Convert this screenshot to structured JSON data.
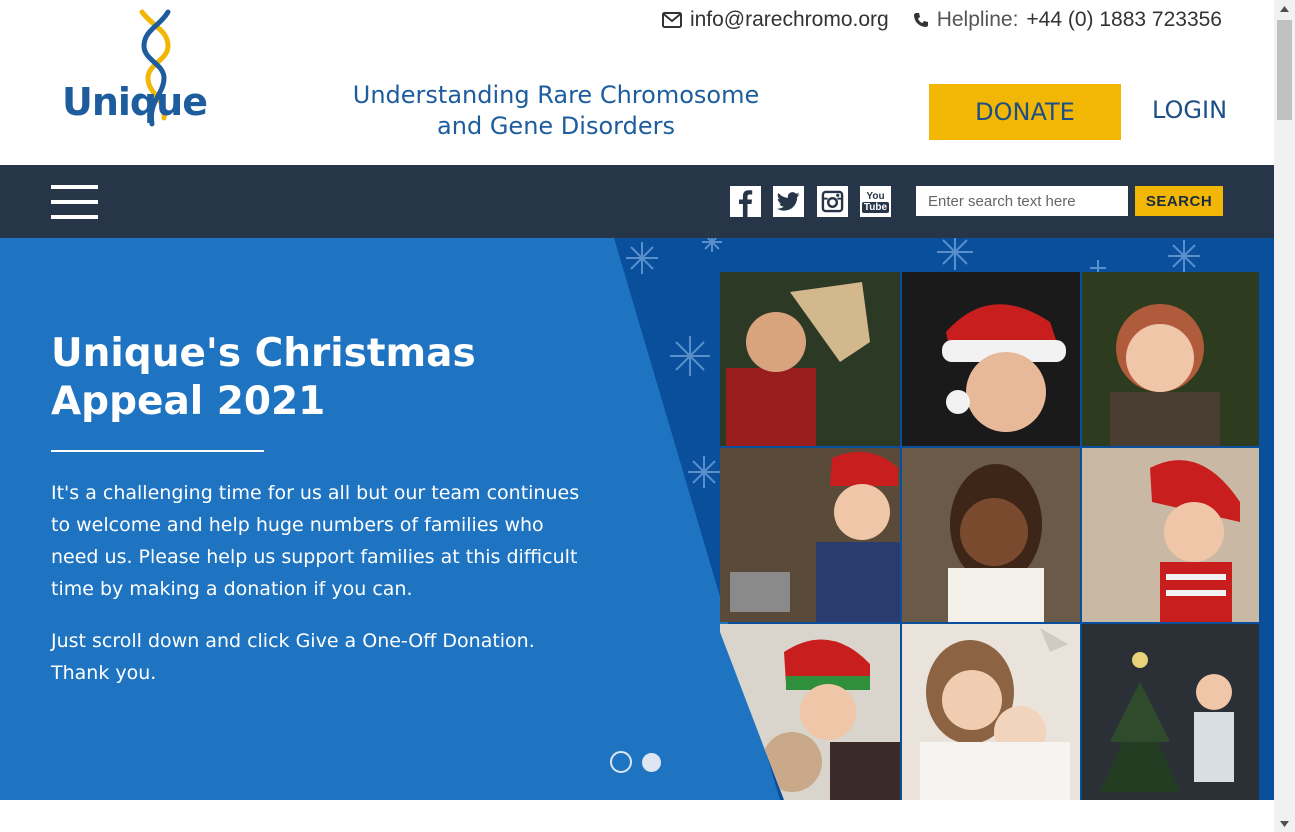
{
  "header": {
    "logo_text": "Unique",
    "email": "info@rarechromo.org",
    "helpline_label": "Helpline:",
    "helpline_number": "+44 (0) 1883 723356",
    "tagline_line1": "Understanding Rare Chromosome",
    "tagline_line2": "and Gene Disorders",
    "donate_label": "DONATE",
    "login_label": "LOGIN"
  },
  "nav": {
    "social_icons": [
      "facebook-icon",
      "twitter-icon",
      "instagram-icon",
      "youtube-icon"
    ],
    "youtube_line1": "You",
    "youtube_line2": "Tube",
    "search_placeholder": "Enter search text here",
    "search_button": "SEARCH"
  },
  "hero": {
    "title": "Unique's Christmas Appeal 2021",
    "paragraph1": "It's a challenging time for us all but our team continues to welcome and help huge numbers of families who need us. Please help us support families at this difficult time by making a donation if you can.",
    "paragraph2": "Just scroll down and click Give a One-Off Donation. Thank you.",
    "slides_total": 2,
    "active_slide": 2
  },
  "colors": {
    "brand_blue": "#1d5d9e",
    "accent_yellow": "#f2b705",
    "nav_dark": "#263548",
    "hero_blue": "#0f5cae"
  }
}
